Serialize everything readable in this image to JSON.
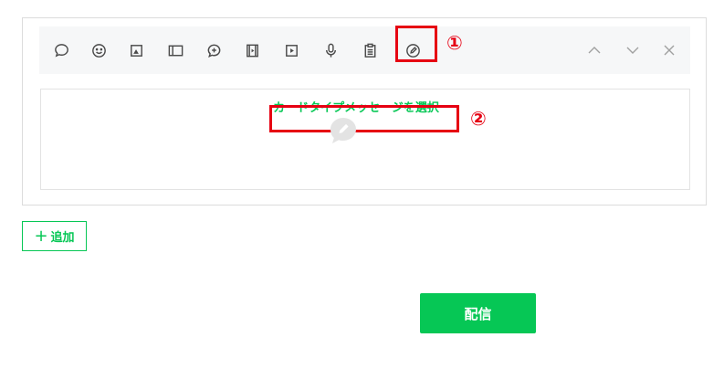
{
  "toolbar": {
    "tools": [
      {
        "name": "speech-bubble-icon"
      },
      {
        "name": "smiley-icon"
      },
      {
        "name": "image-icon"
      },
      {
        "name": "rich-message-icon"
      },
      {
        "name": "coupon-icon"
      },
      {
        "name": "film-icon"
      },
      {
        "name": "play-icon"
      },
      {
        "name": "microphone-icon"
      },
      {
        "name": "clipboard-icon"
      },
      {
        "name": "card-message-icon",
        "selected": true
      }
    ],
    "nav": [
      "chevron-up-icon",
      "chevron-down-icon",
      "close-icon"
    ]
  },
  "annotations": {
    "step1": "①",
    "step2": "②",
    "highlight_color": "#e60012"
  },
  "content": {
    "select_card_label": "カードタイプメッセージを選択",
    "center_icon": "pencil-bubble-icon"
  },
  "actions": {
    "add_label": "追加",
    "add_plus": "+",
    "deliver_label": "配信"
  },
  "colors": {
    "accent": "#06c755",
    "icon": "#4a4a4a",
    "nav_icon": "#a0a0a0",
    "placeholder_icon": "#e3e3e3"
  }
}
